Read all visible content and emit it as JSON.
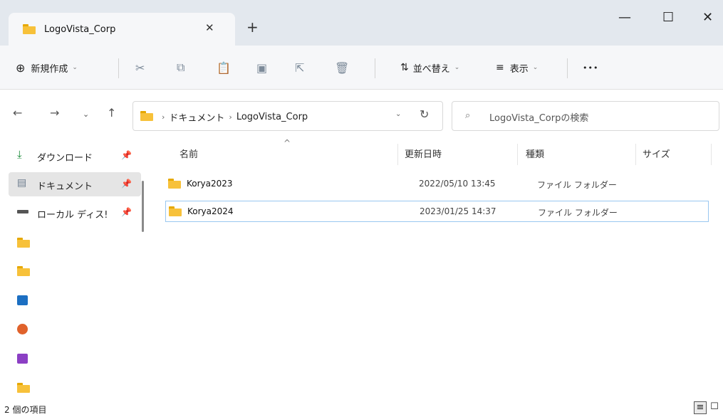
{
  "window": {
    "tab_title": "LogoVista_Corp",
    "tab_close": "✕",
    "new_tab": "+",
    "minimize": "—",
    "maximize": "☐",
    "close": "✕"
  },
  "toolbar": {
    "new_label": "新規作成",
    "sort_label": "並べ替え",
    "view_label": "表示",
    "more_label": "•••",
    "chevron": "⌄"
  },
  "address": {
    "breadcrumbs": [
      "ドキュメント",
      "LogoVista_Corp"
    ],
    "search_placeholder": "LogoVista_Corpの検索"
  },
  "sidebar": {
    "items": [
      {
        "label": "ダウンロード",
        "icon": "download-icon",
        "pinned": true
      },
      {
        "label": "ドキュメント",
        "icon": "document-icon",
        "pinned": true,
        "selected": true
      },
      {
        "label": "ローカル ディス!",
        "icon": "drive-icon",
        "pinned": true
      },
      {
        "label": "",
        "icon": "folder-icon"
      },
      {
        "label": "",
        "icon": "folder-icon"
      },
      {
        "label": "",
        "icon": "pictures-icon"
      },
      {
        "label": "",
        "icon": "music-icon"
      },
      {
        "label": "",
        "icon": "videos-icon"
      },
      {
        "label": "",
        "icon": "folder-icon"
      }
    ]
  },
  "columns": {
    "name": "名前",
    "modified": "更新日時",
    "type": "種類",
    "size": "サイズ"
  },
  "files": [
    {
      "name": "Korya2023",
      "modified": "2022/05/10 13:45",
      "type": "ファイル フォルダー"
    },
    {
      "name": "Korya2024",
      "modified": "2023/01/25 14:37",
      "type": "ファイル フォルダー",
      "selected": true
    }
  ],
  "status": {
    "item_count": "2 個の項目"
  },
  "colors": {
    "accent": "#0067c0",
    "folder": "#f7c13a",
    "selection_border": "#99c7f0"
  }
}
